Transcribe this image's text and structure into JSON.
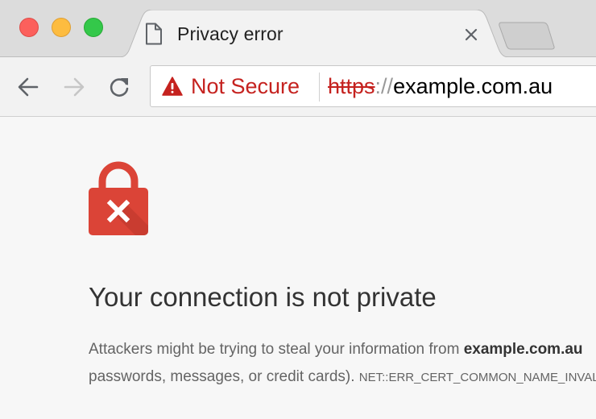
{
  "tab": {
    "title": "Privacy error",
    "icon": "document-icon"
  },
  "toolbar": {
    "back_icon": "back-arrow-icon",
    "forward_icon": "forward-arrow-icon",
    "reload_icon": "reload-icon"
  },
  "omnibox": {
    "security_label": "Not Secure",
    "security_color": "#c5221f",
    "url_scheme": "https",
    "url_separator": "://",
    "url_host": "example.com.au"
  },
  "page": {
    "heading": "Your connection is not private",
    "line1_prefix": "Attackers might be trying to steal your information from ",
    "line1_site": "example.com.au",
    "line2_text": "passwords, messages, or credit cards). ",
    "error_code": "NET::ERR_CERT_COMMON_NAME_INVALID",
    "accent_color": "#db4437"
  }
}
